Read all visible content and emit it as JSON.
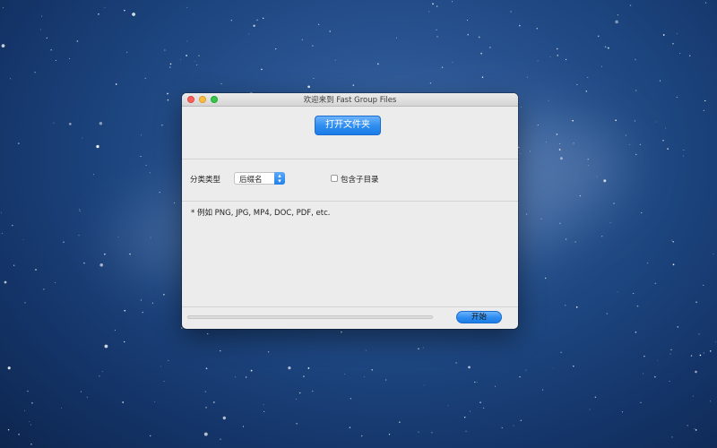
{
  "window": {
    "title": "欢迎来到 Fast Group Files"
  },
  "main": {
    "open_folder_label": "打开文件夹",
    "category_label": "分类类型",
    "category_select_value": "后缀名",
    "include_subdirs_label": "包含子目录",
    "include_subdirs_checked": false,
    "hint_text": "* 例如 PNG, JPG, MP4, DOC, PDF, etc.",
    "progress_fraction": 0,
    "start_label": "开始"
  },
  "colors": {
    "accent": "#2d8cf0",
    "close": "#fc605c",
    "minimize": "#fdbc40",
    "maximize": "#34c84a"
  }
}
